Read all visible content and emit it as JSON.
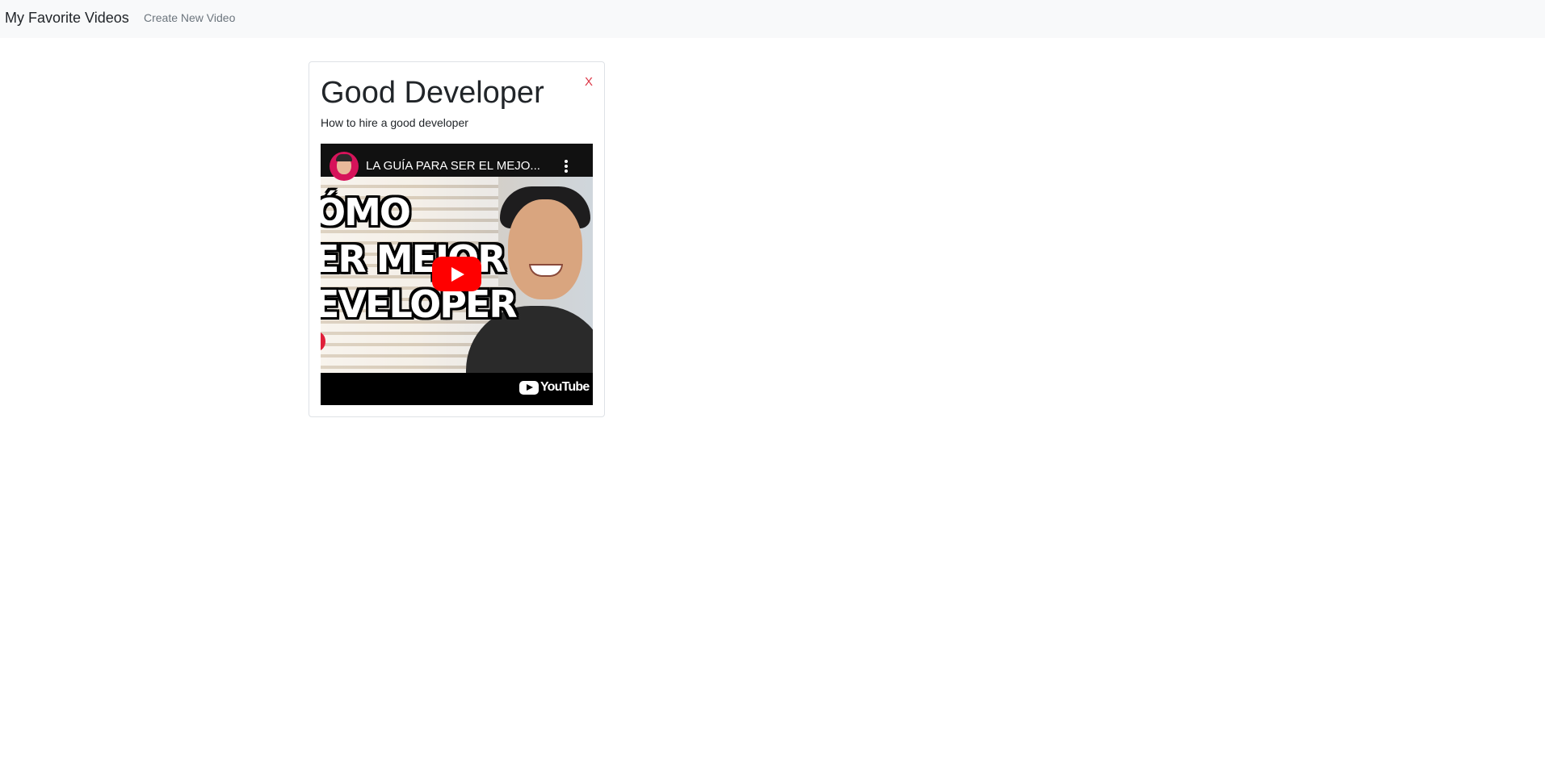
{
  "navbar": {
    "brand": "My Favorite Videos",
    "links": [
      {
        "label": "Create New Video"
      }
    ]
  },
  "videos": [
    {
      "title": "Good Developer",
      "description": "How to hire a good developer",
      "delete_label": "X",
      "embed": {
        "video_title": "LA GUÍA PARA SER EL MEJO...",
        "thumbnail_text": [
          "ÓMO",
          "ER MEJOR",
          "EVELOPER"
        ],
        "platform": "YouTube",
        "icons": [
          "channel-avatar",
          "more-options-icon",
          "play-icon",
          "youtube-logo-icon"
        ]
      }
    }
  ],
  "colors": {
    "navbar_bg": "#f8f9fa",
    "delete_red": "#dc3545",
    "play_red": "#ff0000",
    "link_gray": "#6c757d"
  }
}
